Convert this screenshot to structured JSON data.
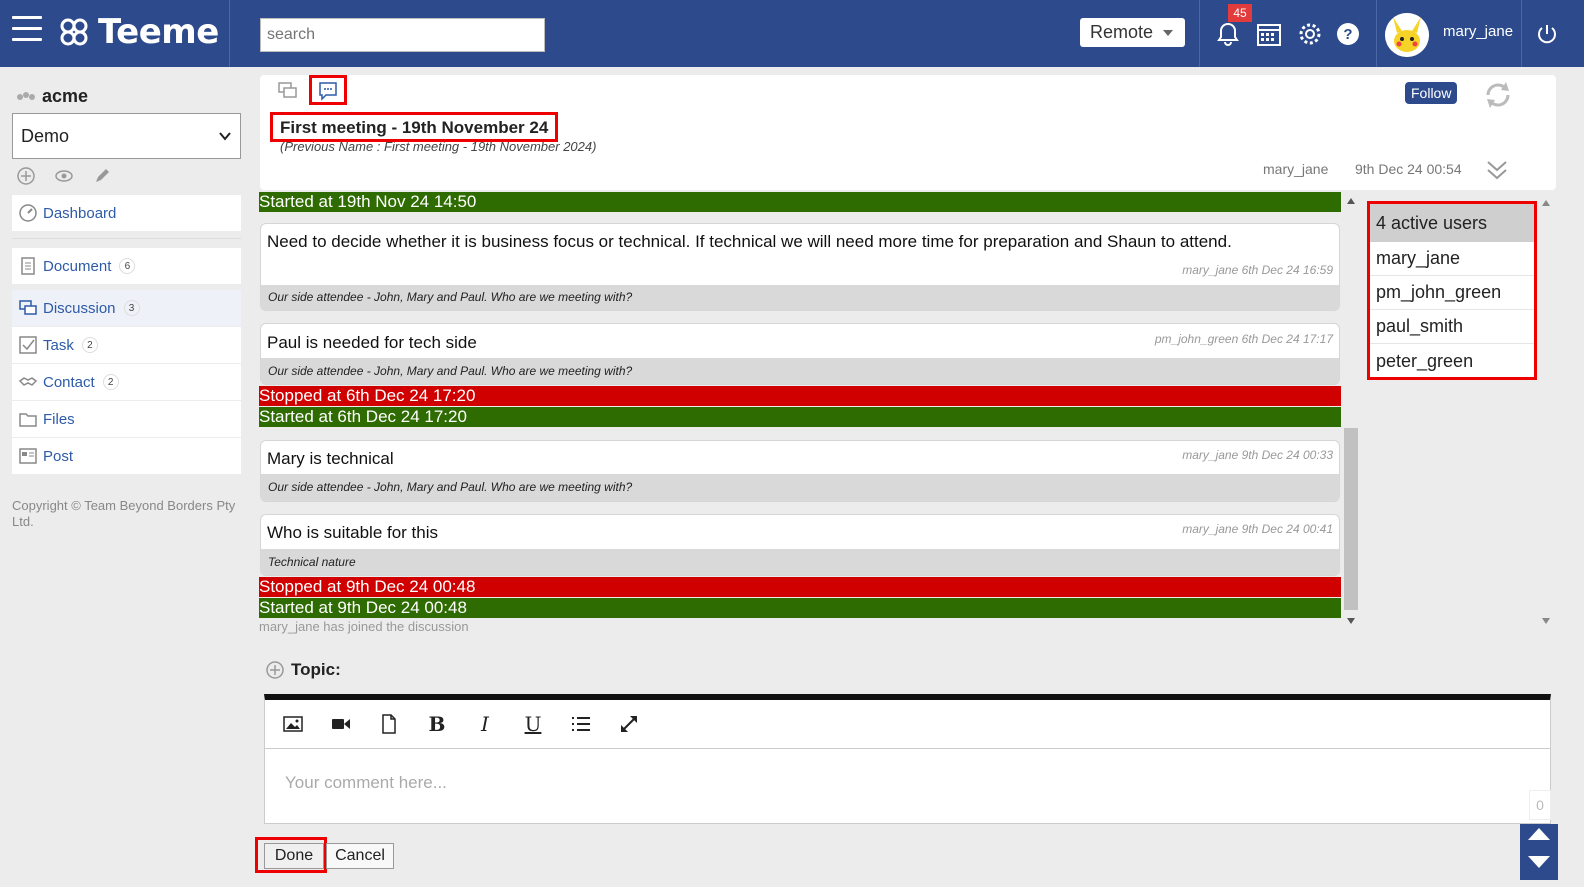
{
  "app": {
    "brand": "Teeme"
  },
  "header": {
    "search_placeholder": "search",
    "mode_label": "Remote",
    "notification_count": "45",
    "username": "mary_jane"
  },
  "sidebar": {
    "org_name": "acme",
    "workspace": "Demo",
    "items": [
      {
        "label": "Dashboard",
        "count": ""
      },
      {
        "label": "Document",
        "count": "6"
      },
      {
        "label": "Discussion",
        "count": "3"
      },
      {
        "label": "Task",
        "count": "2"
      },
      {
        "label": "Contact",
        "count": "2"
      },
      {
        "label": "Files",
        "count": ""
      },
      {
        "label": "Post",
        "count": ""
      }
    ],
    "copyright": "Copyright © Team Beyond Borders Pty Ltd."
  },
  "discussion": {
    "title": "First meeting - 19th November 24",
    "previous_name": "(Previous Name   : First meeting - 19th November 2024)",
    "follow_label": "Follow",
    "author": "mary_jane",
    "created": "9th Dec 24 00:54",
    "events": {
      "started1": "Started at 19th Nov 24 14:50",
      "stopped1": "Stopped at 6th Dec 24 17:20",
      "started2": "Started at 6th Dec 24 17:20",
      "stopped2": "Stopped at 9th Dec 24 00:48",
      "started3": "Started at 9th Dec 24 00:48"
    },
    "posts": [
      {
        "text": "Need to decide whether it is business focus or technical. If technical we will need more time for preparation and Shaun to attend.",
        "meta": "mary_jane 6th Dec 24 16:59",
        "topic": "Our side attendee - John, Mary and Paul. Who are we meeting with?"
      },
      {
        "text": "Paul is needed for tech side",
        "meta": "pm_john_green 6th Dec 24 17:17",
        "topic": "Our side attendee - John, Mary and Paul. Who are we meeting with?"
      },
      {
        "text": "Mary is technical",
        "meta": "mary_jane 9th Dec 24 00:33",
        "topic": "Our side attendee - John, Mary and Paul. Who are we meeting with?"
      },
      {
        "text": "Who is suitable for this",
        "meta": "mary_jane 9th Dec 24 00:41",
        "topic": "Technical nature"
      }
    ],
    "joined_note": "mary_jane has joined the discussion"
  },
  "active_users": {
    "heading": "4 active users",
    "users": [
      "mary_jane",
      "pm_john_green",
      "paul_smith",
      "peter_green"
    ]
  },
  "editor": {
    "topic_label": "Topic:",
    "comment_placeholder": "Your comment here...",
    "char_count": "0",
    "done_label": "Done",
    "cancel_label": "Cancel"
  },
  "colors": {
    "header": "#2d4b8c",
    "started": "#2e6b00",
    "stopped": "#d00000",
    "highlight": "#e00000"
  }
}
